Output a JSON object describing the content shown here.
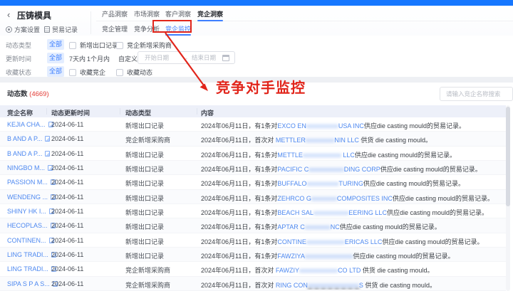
{
  "icons": {
    "back": "‹",
    "range_arrow": "→"
  },
  "colors": {
    "topbar": "#1677ff",
    "accent_blue": "#3d7fff",
    "link_blue": "#4d88f0",
    "annotation_red": "#e1251b",
    "count_red": "#e23b35"
  },
  "header": {
    "title": "压铸模具",
    "actions": [
      {
        "label": "方案设置"
      },
      {
        "label": "贸易记录"
      }
    ],
    "primary_tabs": [
      {
        "label": "产品洞察",
        "active": false
      },
      {
        "label": "市场洞察",
        "active": false
      },
      {
        "label": "客户洞察",
        "active": false
      },
      {
        "label": "竞企洞察",
        "active": true
      }
    ],
    "secondary_tabs": [
      {
        "label": "竞企管理",
        "active": false
      },
      {
        "label": "竞争分析",
        "active": false
      },
      {
        "label": "竞企监控",
        "active": true
      }
    ]
  },
  "filters": {
    "type_row": {
      "label": "动态类型",
      "all": "全部",
      "checkboxes": [
        "新增出口记录",
        "竞企新增采购商"
      ]
    },
    "time_row": {
      "label": "更新时间",
      "all": "全部",
      "options": [
        "7天内",
        "1个月内",
        "自定义"
      ],
      "start_placeholder": "开始日期",
      "end_placeholder": "结束日期"
    },
    "favorite_row": {
      "label": "收藏状态",
      "all": "全部",
      "checkboxes": [
        "收藏竞企",
        "收藏动态"
      ]
    }
  },
  "annotation": {
    "text": "竞争对手监控"
  },
  "list": {
    "count_label": "动态数",
    "count": "(4669)",
    "search_placeholder": "请输入竞企名称搜索",
    "columns": [
      "竞企名称",
      "动态更新时间",
      "动态类型",
      "内容"
    ],
    "rows": [
      {
        "name": "KEJIA CHA...",
        "date": "2024-06-11",
        "type": "新增出口记录",
        "content": [
          {
            "t": "2024年06月11日，有1条对",
            "s": "t"
          },
          {
            "t": "EXCO EN",
            "s": "l"
          },
          {
            "t": "xxxxxxxxxx",
            "s": "b"
          },
          {
            "t": "USA INC",
            "s": "l"
          },
          {
            "t": "供应die casting mould的贸易记录。",
            "s": "t"
          }
        ]
      },
      {
        "name": "B AND A P...",
        "date": "2024-06-11",
        "type": "竞企新增采购商",
        "content": [
          {
            "t": "2024年06月11日，首次对 ",
            "s": "t"
          },
          {
            "t": "METTLER",
            "s": "l"
          },
          {
            "t": "xxxxxxxxx",
            "s": "b"
          },
          {
            "t": "NIN LLC",
            "s": "l"
          },
          {
            "t": " 供货 die casting mould。",
            "s": "t"
          }
        ]
      },
      {
        "name": "B AND A P...",
        "date": "2024-06-11",
        "type": "新增出口记录",
        "content": [
          {
            "t": "2024年06月11日，有1条对",
            "s": "t"
          },
          {
            "t": "METTLE",
            "s": "l"
          },
          {
            "t": "xxxxxxxxxxxx",
            "s": "b"
          },
          {
            "t": " LLC",
            "s": "l"
          },
          {
            "t": "供应die casting mould的贸易记录。",
            "s": "t"
          }
        ]
      },
      {
        "name": "NINGBO M...",
        "date": "2024-06-11",
        "type": "新增出口记录",
        "content": [
          {
            "t": "2024年06月11日，有1条对",
            "s": "t"
          },
          {
            "t": "PACIFIC C",
            "s": "l"
          },
          {
            "t": "xxxxxxxxxxx",
            "s": "b"
          },
          {
            "t": "DING CORP",
            "s": "l"
          },
          {
            "t": "供应die casting mould的贸易记录。",
            "s": "t"
          }
        ]
      },
      {
        "name": "PASSION M...",
        "date": "2024-06-11",
        "type": "新增出口记录",
        "content": [
          {
            "t": "2024年06月11日，有1条对",
            "s": "t"
          },
          {
            "t": "BUFFALO",
            "s": "l"
          },
          {
            "t": "xxxxxxxxxx",
            "s": "b"
          },
          {
            "t": "TURING",
            "s": "l"
          },
          {
            "t": "供应die casting mould的贸易记录。",
            "s": "t"
          }
        ]
      },
      {
        "name": "WENDENG ...",
        "date": "2024-06-11",
        "type": "新增出口记录",
        "content": [
          {
            "t": "2024年06月11日，有1条对",
            "s": "t"
          },
          {
            "t": "ZEHRCO G",
            "s": "l"
          },
          {
            "t": "xxxxxxxx",
            "s": "b"
          },
          {
            "t": "COMPOSITES INC",
            "s": "l"
          },
          {
            "t": "供应die casting mould的贸易记录。",
            "s": "t"
          }
        ]
      },
      {
        "name": "SHINY HK I...",
        "date": "2024-06-11",
        "type": "新增出口记录",
        "content": [
          {
            "t": "2024年06月11日，有1条对",
            "s": "t"
          },
          {
            "t": "BEACH SAL",
            "s": "l"
          },
          {
            "t": "xxxxxxxxxxx",
            "s": "b"
          },
          {
            "t": "EERING LLC",
            "s": "l"
          },
          {
            "t": "供应die casting mould的贸易记录。",
            "s": "t"
          }
        ]
      },
      {
        "name": "HECOPLAS...",
        "date": "2024-06-11",
        "type": "新增出口记录",
        "content": [
          {
            "t": "2024年06月11日，有1条对",
            "s": "t"
          },
          {
            "t": "APTAR C",
            "s": "l"
          },
          {
            "t": "xxxxxxxx",
            "s": "b"
          },
          {
            "t": "NC",
            "s": "l"
          },
          {
            "t": "供应die casting mould的贸易记录。",
            "s": "t"
          }
        ]
      },
      {
        "name": "CONTINEN...",
        "date": "2024-06-11",
        "type": "新增出口记录",
        "content": [
          {
            "t": "2024年06月11日，有1条对",
            "s": "t"
          },
          {
            "t": "CONTINE",
            "s": "l"
          },
          {
            "t": "xxxxxxxxxxxx",
            "s": "b"
          },
          {
            "t": "ERICAS LLC",
            "s": "l"
          },
          {
            "t": "供应die casting mould的贸易记录。",
            "s": "t"
          }
        ]
      },
      {
        "name": "LING TRADI...",
        "date": "2024-06-11",
        "type": "新增出口记录",
        "content": [
          {
            "t": "2024年06月11日，有1条对",
            "s": "t"
          },
          {
            "t": "FAWZIYA",
            "s": "l"
          },
          {
            "t": "xxxxxxxxxxxxxxx",
            "s": "b"
          },
          {
            "t": "供应die casting mould的贸易记录。",
            "s": "t"
          }
        ]
      },
      {
        "name": "LING TRADI...",
        "date": "2024-06-11",
        "type": "竞企新增采购商",
        "content": [
          {
            "t": "2024年06月11日，首次对 ",
            "s": "t"
          },
          {
            "t": "FAWZIY",
            "s": "l"
          },
          {
            "t": "xxxxxxxxxxxx",
            "s": "b"
          },
          {
            "t": "CO LTD",
            "s": "l"
          },
          {
            "t": " 供货 die casting mould。",
            "s": "t"
          }
        ]
      },
      {
        "name": "SIPA S P A S...",
        "date": "2024-06-11",
        "type": "竞企新增采购商",
        "content": [
          {
            "t": "2024年06月11日，首次对 ",
            "s": "t"
          },
          {
            "t": "RING CON",
            "s": "l"
          },
          {
            "t": "xxxxxxxxxxxxxxxx",
            "s": "bd"
          },
          {
            "t": "S",
            "s": "l"
          },
          {
            "t": " 供货 die casting mould。",
            "s": "t"
          }
        ]
      }
    ]
  }
}
